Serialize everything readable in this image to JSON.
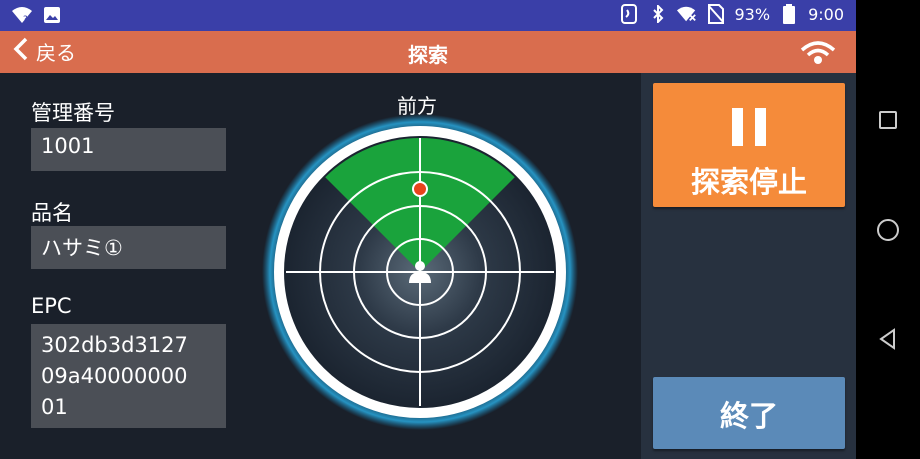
{
  "status_bar": {
    "battery": "93%",
    "time": "9:00"
  },
  "app_bar": {
    "back_label": "戻る",
    "title": "探索"
  },
  "fields": {
    "management_number_label": "管理番号",
    "management_number_value": "1001",
    "item_name_label": "品名",
    "item_name_value": "ハサミ①",
    "epc_label": "EPC",
    "epc_lines": [
      "302db3d3127",
      "09a40000000",
      "01"
    ]
  },
  "radar": {
    "direction_label": "前方"
  },
  "buttons": {
    "pause_label": "探索停止",
    "end_label": "終了"
  },
  "colors": {
    "status_bar": "#3a3fa8",
    "app_bar": "#d96d4e",
    "pause_button": "#f58b3a",
    "end_button": "#5b8ab8",
    "radar_sector": "#1aa33c",
    "target_dot": "#e8441c"
  },
  "icons": {
    "status_left": [
      "wifi-question-icon",
      "image-icon"
    ],
    "status_right": [
      "nfc-icon",
      "bluetooth-icon",
      "wifi-off-icon",
      "no-sim-icon",
      "battery-icon"
    ],
    "nav": [
      "recent-apps-icon",
      "home-icon",
      "back-nav-icon"
    ]
  }
}
